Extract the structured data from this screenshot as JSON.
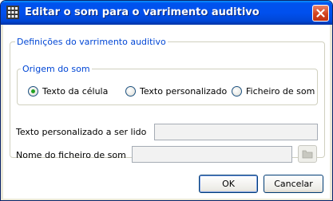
{
  "window": {
    "title": "Editar o som para o varrimento auditivo"
  },
  "settings_group": {
    "legend": "Definições do varrimento auditivo"
  },
  "origin_group": {
    "legend": "Origem do som",
    "options": [
      {
        "label": "Texto da célula",
        "checked": true
      },
      {
        "label": "Texto personalizado",
        "checked": false
      },
      {
        "label": "Ficheiro de som",
        "checked": false
      }
    ]
  },
  "custom_text": {
    "label": "Texto personalizado a ser lido",
    "value": ""
  },
  "sound_file": {
    "label": "Nome do ficheiro de som",
    "value": ""
  },
  "buttons": {
    "ok": "OK",
    "cancel": "Cancelar"
  },
  "icons": {
    "app": "grid-icon",
    "close": "close-icon",
    "browse": "folder-icon"
  }
}
